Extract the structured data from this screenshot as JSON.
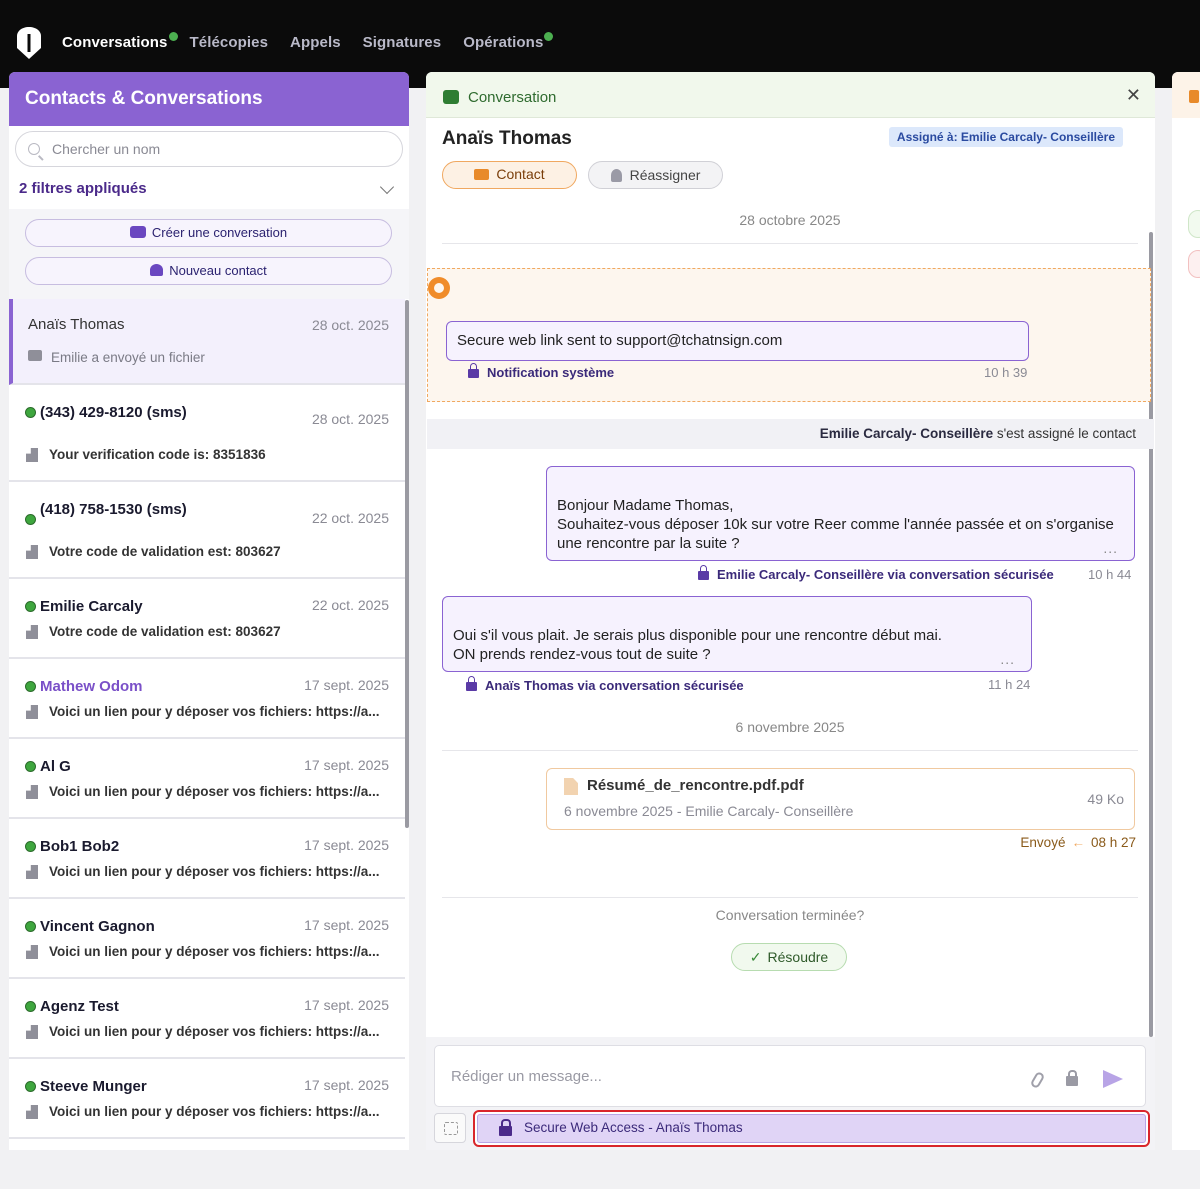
{
  "nav": {
    "items": [
      {
        "label": "Conversations",
        "active": true,
        "dot": true
      },
      {
        "label": "Télécopies",
        "active": false,
        "dot": false
      },
      {
        "label": "Appels",
        "active": false,
        "dot": false
      },
      {
        "label": "Signatures",
        "active": false,
        "dot": false
      },
      {
        "label": "Opérations",
        "active": false,
        "dot": true
      }
    ]
  },
  "left": {
    "title": "Contacts & Conversations",
    "search_placeholder": "Chercher un nom",
    "filters_label": "2 filtres appliqués",
    "create_conversation": "Créer une conversation",
    "new_contact": "Nouveau contact",
    "items": [
      {
        "name": "Anaïs Thomas",
        "date": "28 oct. 2025",
        "preview": "Emilie a envoyé un fichier"
      },
      {
        "name": "(343) 429-8120 (sms)",
        "date": "28 oct. 2025",
        "preview": "Your verification code is: 8351836"
      },
      {
        "name": "(418) 758-1530 (sms)",
        "date": "22 oct. 2025",
        "preview": "Votre code de validation est: 803627"
      },
      {
        "name": "Emilie Carcaly",
        "date": "22 oct. 2025",
        "preview": "Votre code de validation est: 803627"
      },
      {
        "name": "Mathew Odom",
        "date": "17 sept. 2025",
        "preview": "Voici un lien pour y déposer vos fichiers: https://a..."
      },
      {
        "name": "Al G",
        "date": "17 sept. 2025",
        "preview": "Voici un lien pour y déposer vos fichiers: https://a..."
      },
      {
        "name": "Bob1 Bob2",
        "date": "17 sept. 2025",
        "preview": "Voici un lien pour y déposer vos fichiers: https://a..."
      },
      {
        "name": "Vincent Gagnon",
        "date": "17 sept. 2025",
        "preview": "Voici un lien pour y déposer vos fichiers: https://a..."
      },
      {
        "name": "Agenz Test",
        "date": "17 sept. 2025",
        "preview": "Voici un lien pour y déposer vos fichiers: https://a..."
      },
      {
        "name": "Steeve Munger",
        "date": "17 sept. 2025",
        "preview": "Voici un lien pour y déposer vos fichiers: https://a..."
      }
    ]
  },
  "conv": {
    "header": "Conversation",
    "contact_name": "Anaïs Thomas",
    "assigned": "Assigné à: Emilie Carcaly- Conseillère",
    "contact_btn": "Contact",
    "reassign_btn": "Réassigner",
    "date1": "28 octobre 2025",
    "system_msg": "Secure web link sent to support@tchatnsign.com",
    "system_label": "Notification système",
    "system_time": "10 h 39",
    "assign_name": "Emilie Carcaly- Conseillère",
    "assign_text": " s'est assigné le contact",
    "msg1": "Bonjour Madame Thomas,\nSouhaitez-vous déposer 10k sur votre Reer comme l'année passée et on s'organise une rencontre par la suite ?",
    "msg1_meta": "Emilie Carcaly- Conseillère via conversation sécurisée",
    "msg1_time": "10 h 44",
    "msg2": "Oui s'il vous plait. Je serais plus disponible pour une rencontre début mai.\nON prends rendez-vous tout de suite ?",
    "msg2_meta": "Anaïs Thomas via conversation sécurisée",
    "msg2_time": "11 h 24",
    "date2": "6 novembre 2025",
    "file_name": "Résumé_de_rencontre.pdf.pdf",
    "file_sub": "6 novembre 2025 - Emilie Carcaly- Conseillère",
    "file_size": "49 Ko",
    "sent_label": "Envoyé",
    "sent_time": "08 h 27",
    "ended": "Conversation terminée?",
    "resolve": "Résoudre",
    "composer_placeholder": "Rédiger un message...",
    "swa": "Secure Web Access - Anaïs Thomas",
    "more": "..."
  },
  "colors": {
    "accent": "#8a63d2",
    "green": "#3ea63e",
    "orange": "#f0a860",
    "highlight": "#d9262c"
  }
}
